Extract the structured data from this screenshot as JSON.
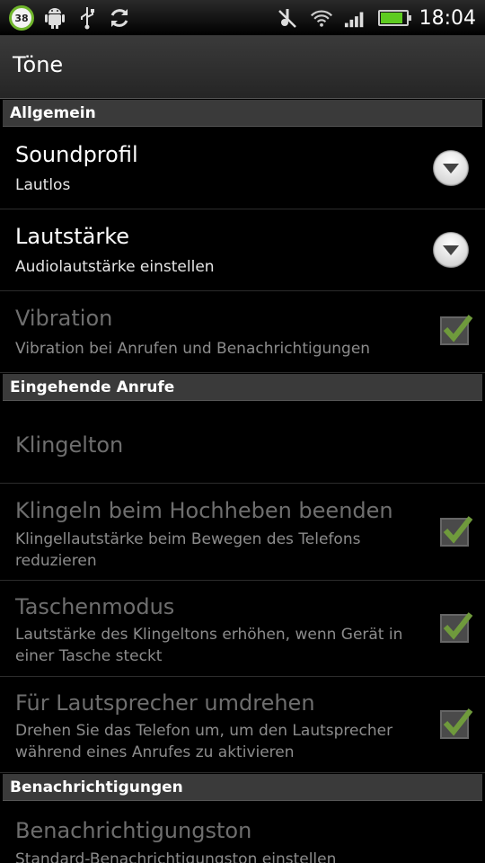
{
  "status_bar": {
    "notification_count": "38",
    "icons_left": [
      "notification-badge",
      "android-icon",
      "usb-icon",
      "sync-icon"
    ],
    "icons_right": [
      "mute-icon",
      "wifi-icon",
      "signal-icon",
      "battery-icon"
    ],
    "battery_level": 0.85,
    "time": "18:04"
  },
  "title": "Töne",
  "sections": {
    "general": "Allgemein",
    "incoming_calls": "Eingehende Anrufe",
    "notifications": "Benachrichtigungen"
  },
  "items": {
    "soundprofile": {
      "title": "Soundprofil",
      "summary": "Lautlos"
    },
    "volume": {
      "title": "Lautstärke",
      "summary": "Audiolautstärke einstellen"
    },
    "vibration": {
      "title": "Vibration",
      "summary": "Vibration bei Anrufen und Benachrichtigungen",
      "checked": true,
      "enabled": false
    },
    "ringtone": {
      "title": "Klingelton",
      "enabled": false
    },
    "quiet_ring": {
      "title": "Klingeln beim Hochheben beenden",
      "summary": "Klingellautstärke beim Bewegen des Telefons reduzieren",
      "checked": true,
      "enabled": false
    },
    "pocket_mode": {
      "title": "Taschenmodus",
      "summary": "Lautstärke des Klingeltons erhöhen, wenn Gerät in einer Tasche steckt",
      "checked": true,
      "enabled": false
    },
    "flip_speaker": {
      "title": "Für Lautsprecher umdrehen",
      "summary": "Drehen Sie das Telefon um, um den Lautsprecher während eines Anrufes zu aktivieren",
      "checked": true,
      "enabled": false
    },
    "notification_sound": {
      "title": "Benachrichtigungston",
      "summary": "Standard-Benachrichtigungston einstellen",
      "enabled": false
    }
  },
  "colors": {
    "accent_check": "#7bc934",
    "section_bg": "#3a3a3a",
    "battery": "#5ecb21"
  }
}
